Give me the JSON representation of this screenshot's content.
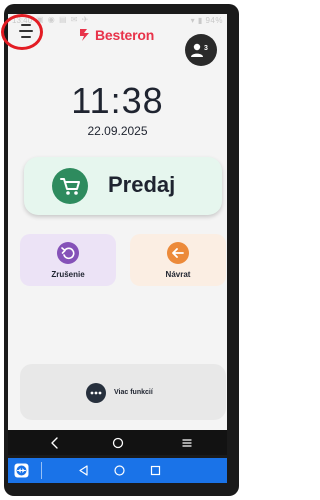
{
  "status_bar": {
    "time": "13:40",
    "battery": "94%"
  },
  "header": {
    "app_name": "Besteron",
    "user_count": "3"
  },
  "clock": {
    "time": "11:38",
    "date": "22.09.2025"
  },
  "actions": {
    "sale_label": "Predaj",
    "cancel_label": "Zrušenie",
    "return_label": "Návrat",
    "more_label": "Viac funkcií"
  },
  "colors": {
    "brand": "#e8334a",
    "sale_bg": "#e6f6ee",
    "sale_accent": "#2e8b5e",
    "cancel_bg": "#ece3f6",
    "cancel_accent": "#8552b8",
    "return_bg": "#fbeee3",
    "return_accent": "#ec8a3a",
    "highlight_ring": "#e31c23",
    "remote_bar": "#1a73e8"
  },
  "icons": {
    "menu": "menu-icon",
    "user": "person-icon",
    "sale": "shopping-cart-icon",
    "cancel": "undo-icon",
    "return": "arrow-left-icon",
    "more": "more-dots-icon"
  }
}
